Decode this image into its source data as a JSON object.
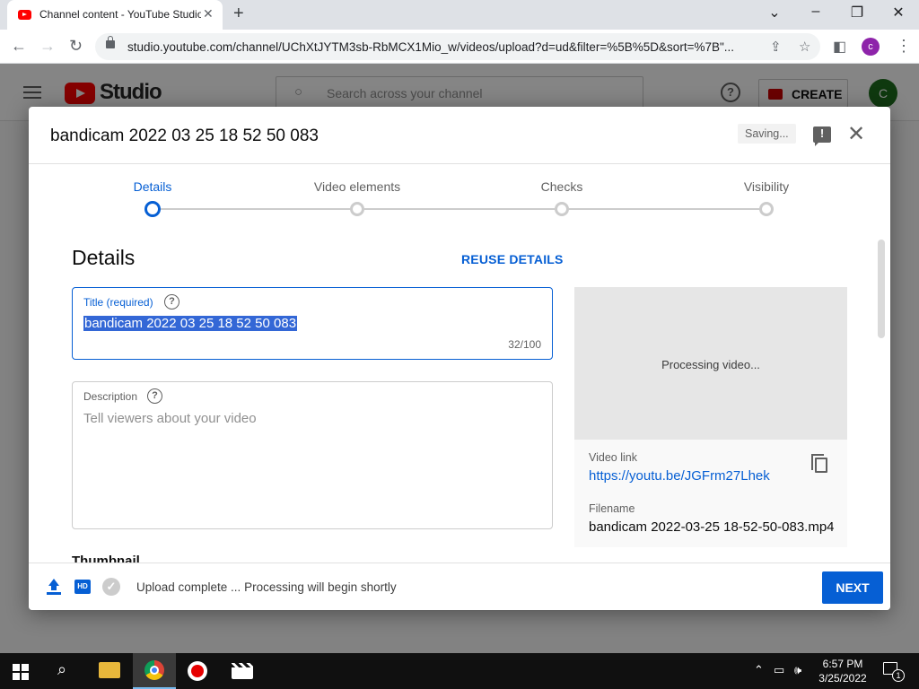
{
  "browser": {
    "tab_title": "Channel content - YouTube Studio",
    "url": "studio.youtube.com/channel/UChXtJYTM3sb-RbMCX1Mio_w/videos/upload?d=ud&filter=%5B%5D&sort=%7B\"...",
    "profile_initial": "c"
  },
  "studio": {
    "brand": "Studio",
    "search_placeholder": "Search across your channel",
    "create_label": "CREATE",
    "avatar_initial": "C"
  },
  "dialog": {
    "title": "bandicam 2022 03 25 18 52 50 083",
    "saving_label": "Saving...",
    "steps": [
      {
        "label": "Details",
        "active": true
      },
      {
        "label": "Video elements",
        "active": false
      },
      {
        "label": "Checks",
        "active": false
      },
      {
        "label": "Visibility",
        "active": false
      }
    ],
    "section_heading": "Details",
    "reuse_label": "REUSE DETAILS",
    "title_field": {
      "label": "Title (required)",
      "value": "bandicam 2022 03 25 18 52 50 083",
      "counter": "32/100"
    },
    "description_field": {
      "label": "Description",
      "placeholder": "Tell viewers about your video"
    },
    "thumbnail_heading": "Thumbnail",
    "preview_status": "Processing video...",
    "video_link_label": "Video link",
    "video_link": "https://youtu.be/JGFrm27Lhek",
    "filename_label": "Filename",
    "filename": "bandicam 2022-03-25 18-52-50-083.mp4",
    "upload_status": "Upload complete ... Processing will begin shortly",
    "hd_badge": "HD",
    "next_label": "NEXT"
  },
  "taskbar": {
    "time": "6:57 PM",
    "date": "3/25/2022",
    "notification_count": "1"
  },
  "colors": {
    "accent": "#065fd4",
    "youtube_red": "#ff0000"
  }
}
